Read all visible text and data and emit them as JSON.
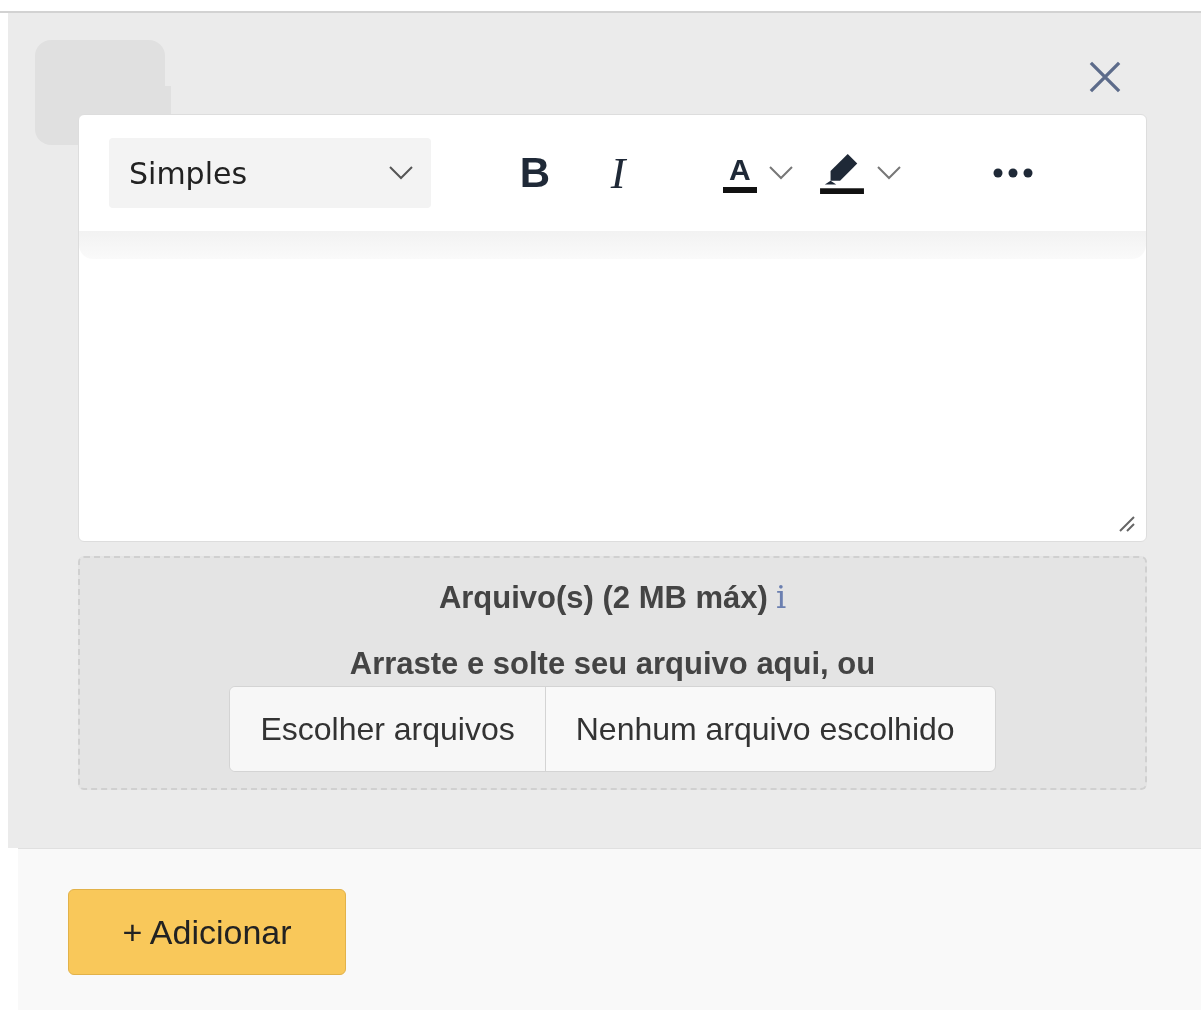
{
  "editor": {
    "format_select": {
      "value": "Simples"
    },
    "toolbar": [
      {
        "kind": "bold",
        "label": "B"
      },
      {
        "kind": "italic",
        "label": "I"
      },
      {
        "kind": "font-color",
        "label": "A"
      },
      {
        "kind": "highlight"
      },
      {
        "kind": "more"
      }
    ]
  },
  "attachments": {
    "title": "Arquivo(s) (2 MB máx)",
    "info": "i",
    "hint": "Arraste e solte seu arquivo aqui, ou",
    "choose_button": "Escolher arquivos",
    "file_status": "Nenhum arquivo escolhido"
  },
  "footer": {
    "add_button": "+ Adicionar"
  }
}
